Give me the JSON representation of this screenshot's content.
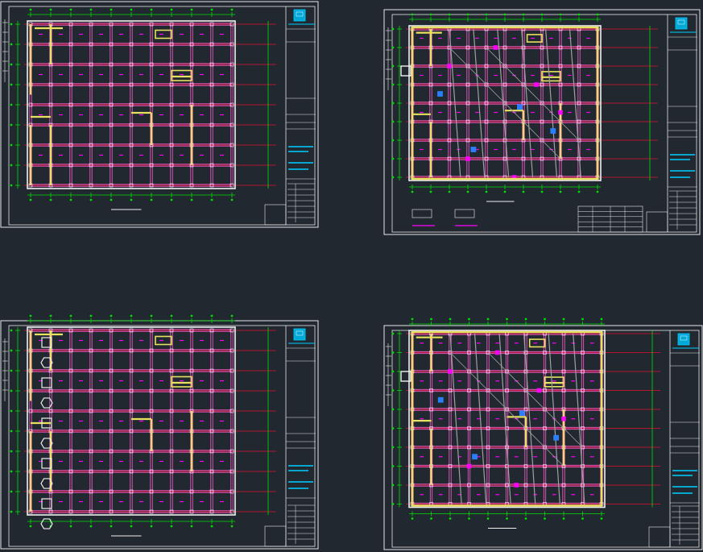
{
  "colors": {
    "background": "#212830",
    "frame": "#e8e8e8",
    "axis": "#00e000",
    "grid": "#e01030",
    "beam": "#ff60d0",
    "wall": "#e8e060",
    "column": "#f0f0f0",
    "pink": "#ff00ff",
    "cyan": "#00d0ff",
    "blue": "#2a7fff",
    "gray": "#a0a0a0"
  },
  "sheets": [
    {
      "name": "sheet-top-left",
      "logo": "logo-icon"
    },
    {
      "name": "sheet-top-right",
      "logo": "logo-icon"
    },
    {
      "name": "sheet-bottom-left",
      "logo": "logo-icon"
    },
    {
      "name": "sheet-bottom-right",
      "logo": "logo-icon"
    }
  ]
}
